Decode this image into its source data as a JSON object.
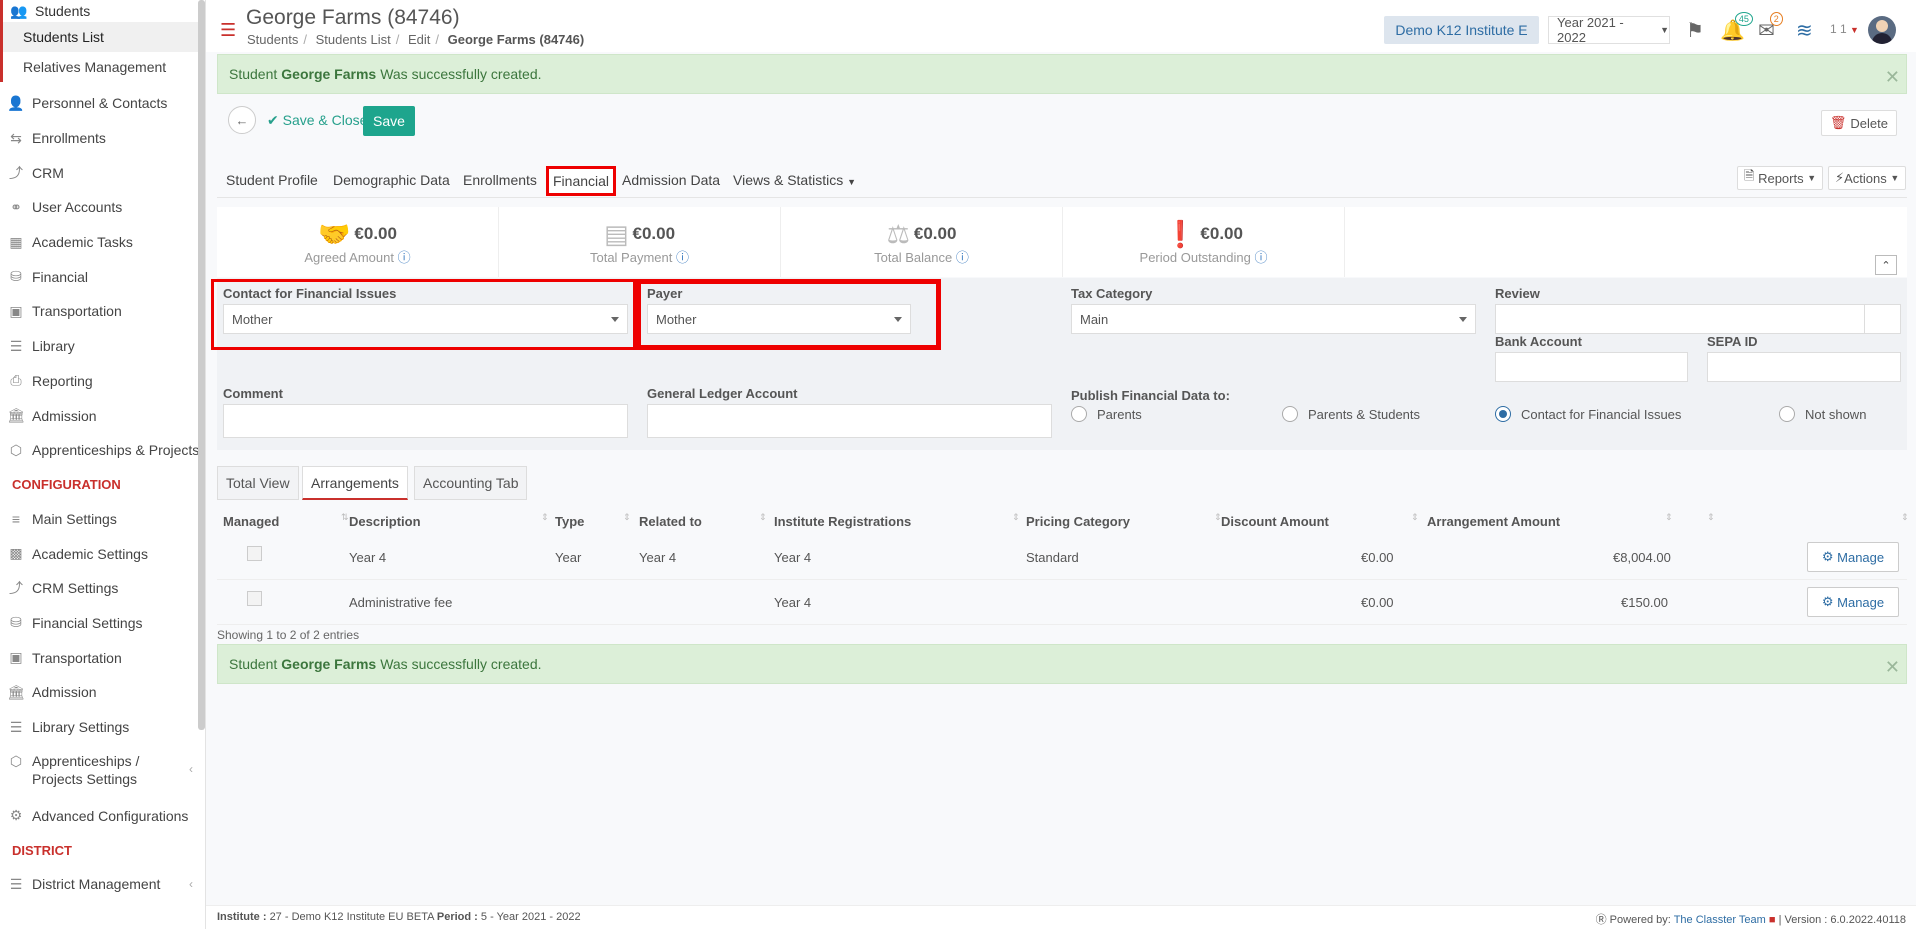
{
  "sidebar": {
    "students": "Students",
    "students_list": "Students List",
    "relatives": "Relatives Management",
    "items": [
      {
        "label": "Personnel & Contacts",
        "icon": "users-icon"
      },
      {
        "label": "Enrollments",
        "icon": "exchange-icon"
      },
      {
        "label": "CRM",
        "icon": "crm-icon"
      },
      {
        "label": "User Accounts",
        "icon": "key-icon"
      },
      {
        "label": "Academic Tasks",
        "icon": "grid-icon"
      },
      {
        "label": "Financial",
        "icon": "coins-icon"
      },
      {
        "label": "Transportation",
        "icon": "bus-icon"
      },
      {
        "label": "Library",
        "icon": "library-icon"
      },
      {
        "label": "Reporting",
        "icon": "printer-icon"
      },
      {
        "label": "Admission",
        "icon": "bank-icon"
      },
      {
        "label": "Apprenticeships & Projects",
        "icon": "cube-icon"
      }
    ],
    "configuration_heading": "CONFIGURATION",
    "config_items": [
      {
        "label": "Main Settings",
        "icon": "sliders-icon"
      },
      {
        "label": "Academic Settings",
        "icon": "people-grid-icon"
      },
      {
        "label": "CRM Settings",
        "icon": "crm-icon"
      },
      {
        "label": "Financial Settings",
        "icon": "coins-icon"
      },
      {
        "label": "Transportation",
        "icon": "bus-icon"
      },
      {
        "label": "Admission",
        "icon": "bank-icon"
      },
      {
        "label": "Library Settings",
        "icon": "library-icon"
      },
      {
        "label": "Apprenticeships / Projects Settings",
        "icon": "cube-icon"
      },
      {
        "label": "Advanced Configurations",
        "icon": "gears-icon"
      }
    ],
    "district_heading": "DISTRICT",
    "district_item": "District Management"
  },
  "header": {
    "title": "George Farms (84746)",
    "breadcrumb": [
      "Students",
      "Students List",
      "Edit",
      "George Farms (84746)"
    ],
    "institute": "Demo K12 Institute E",
    "year": "Year 2021 - 2022",
    "notif_count": "45",
    "mail_count": "2",
    "user": "1 1"
  },
  "alert": {
    "prefix": "Student",
    "name": "George Farms",
    "suffix": "Was successfully created."
  },
  "actions": {
    "save_close": "Save & Close",
    "save": "Save",
    "delete": "Delete"
  },
  "tabs": [
    "Student Profile",
    "Demographic Data",
    "Enrollments",
    "Financial",
    "Admission Data",
    "Views & Statistics"
  ],
  "tab_buttons": {
    "reports": "Reports",
    "actions": "Actions"
  },
  "stats": [
    {
      "value": "€0.00",
      "label": "Agreed Amount",
      "icon": "handshake-icon"
    },
    {
      "value": "€0.00",
      "label": "Total Payment",
      "icon": "bar-chart-icon"
    },
    {
      "value": "€0.00",
      "label": "Total Balance",
      "icon": "balance-scale-icon"
    },
    {
      "value": "€0.00",
      "label": "Period Outstanding",
      "icon": "exclamation-icon"
    }
  ],
  "form": {
    "contact_label": "Contact for Financial Issues",
    "contact_value": "Mother",
    "payer_label": "Payer",
    "payer_value": "Mother",
    "tax_label": "Tax Category",
    "tax_value": "Main",
    "review_label": "Review",
    "bank_label": "Bank Account",
    "sepa_label": "SEPA ID",
    "comment_label": "Comment",
    "gl_label": "General Ledger Account",
    "publish_label": "Publish Financial Data to:",
    "publish_options": [
      "Parents",
      "Parents & Students",
      "Contact for Financial Issues",
      "Not shown"
    ],
    "publish_selected": "Contact for Financial Issues"
  },
  "subtabs": [
    "Total View",
    "Arrangements",
    "Accounting Tab"
  ],
  "table": {
    "headers": [
      "Managed",
      "Description",
      "Type",
      "Related to",
      "Institute Registrations",
      "Pricing Category",
      "Discount Amount",
      "Arrangement Amount"
    ],
    "rows": [
      {
        "description": "Year 4",
        "type": "Year",
        "related": "Year 4",
        "registrations": "Year 4",
        "pricing": "Standard",
        "discount": "€0.00",
        "amount": "€8,004.00"
      },
      {
        "description": "Administrative fee",
        "type": "",
        "related": "",
        "registrations": "Year 4",
        "pricing": "",
        "discount": "€0.00",
        "amount": "€150.00"
      }
    ],
    "manage_label": "Manage",
    "showing": "Showing 1 to 2 of 2 entries"
  },
  "footer": {
    "institute_label": "Institute :",
    "institute_value": "27 - Demo K12 Institute EU BETA",
    "period_label": "Period :",
    "period_value": "5 - Year 2021 - 2022",
    "powered": "Powered by:",
    "team": "The Classter Team",
    "version": "| Version : 6.0.2022.40118"
  }
}
